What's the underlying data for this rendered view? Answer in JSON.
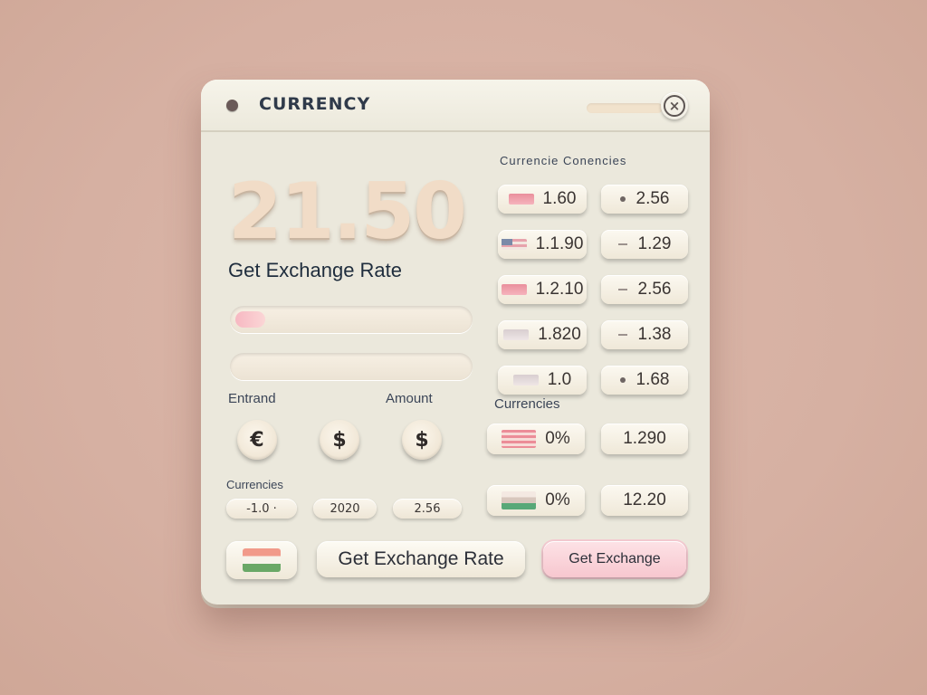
{
  "window": {
    "title": "CURRENCY",
    "close_icon": "close-icon"
  },
  "display": {
    "amount": "21.50",
    "subtitle": "Get Exchange  Rate"
  },
  "bars": {
    "first_fill_fraction": 0.13,
    "second_fill_fraction": 0
  },
  "labels": {
    "left": "Entrand",
    "amount": "Amount",
    "lower": "Currencies",
    "right_header": "Currencie  Conencies",
    "right_mid": "Currencies"
  },
  "coins": [
    {
      "symbol": "€",
      "icon": "euro-coin-icon"
    },
    {
      "symbol": "$",
      "icon": "dollar-coin-icon"
    },
    {
      "symbol": "$",
      "icon": "dollar-coin-icon"
    }
  ],
  "small_pills": [
    "-1.0 ·",
    "2020",
    "2.56"
  ],
  "rates_left": [
    {
      "value": "1.60",
      "flag": "flag-red"
    },
    {
      "value": "1.1.90",
      "flag": "flag-us"
    },
    {
      "value": "1.2.10",
      "flag": "flag-red"
    },
    {
      "value": "1.820",
      "flag": "flag-grey"
    },
    {
      "value": "1.0",
      "flag": "flag-grey"
    },
    {
      "value": "0%",
      "flag": "flag-stripe"
    },
    {
      "value": "0%",
      "flag": "flag-green"
    }
  ],
  "rates_right": [
    "2.56",
    "1.29",
    "2.56",
    "1.38",
    "1.68",
    "1.290",
    "12.20"
  ],
  "buttons": {
    "get_rate": "Get Exchange Rate",
    "get_secondary": "Get Exchange"
  },
  "colors": {
    "background": "#d9b4a6",
    "panel": "#ebe8dc",
    "accent_pink": "#f7c7cf"
  }
}
